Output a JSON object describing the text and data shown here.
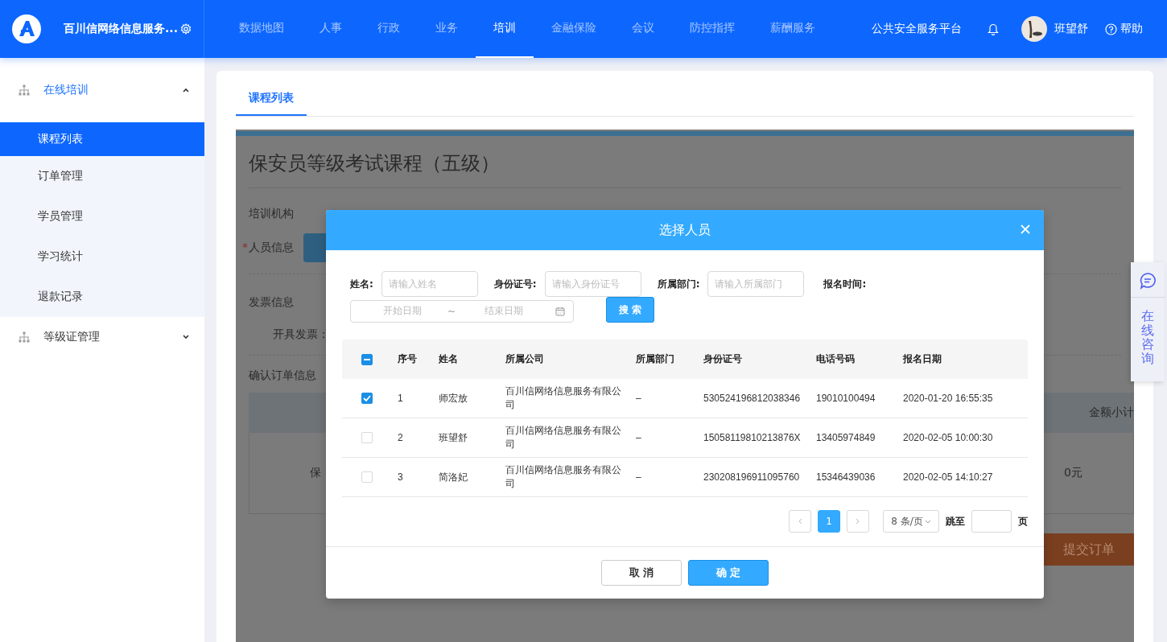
{
  "app": {
    "name": "百川信网络信息服务..."
  },
  "nav": [
    {
      "label": "数据地图",
      "selected": false
    },
    {
      "label": "人事",
      "selected": false
    },
    {
      "label": "行政",
      "selected": false
    },
    {
      "label": "业务",
      "selected": false
    },
    {
      "label": "培训",
      "selected": true
    },
    {
      "label": "金融保险",
      "selected": false
    },
    {
      "label": "会议",
      "selected": false
    },
    {
      "label": "防控指挥",
      "selected": false
    },
    {
      "label": "薪酬服务",
      "selected": false
    }
  ],
  "header_right": {
    "platform": "公共安全服务平台",
    "user": "班望舒",
    "help": "帮助"
  },
  "sidebar": [
    {
      "label": "在线培训",
      "expanded": true,
      "children": [
        {
          "label": "课程列表",
          "selected": true
        },
        {
          "label": "订单管理",
          "selected": false
        },
        {
          "label": "学员管理",
          "selected": false
        },
        {
          "label": "学习统计",
          "selected": false
        },
        {
          "label": "退款记录",
          "selected": false
        }
      ]
    },
    {
      "label": "等级证管理",
      "expanded": false
    }
  ],
  "page_tabs": [
    {
      "label": "课程列表",
      "selected": true
    }
  ],
  "course": {
    "title": "保安员等级考试课程（五级）",
    "org_label": "培训机构",
    "people_label": "人员信息",
    "required_mark": "*",
    "invoice_title": "发票信息",
    "invoice_label": "开具发票：",
    "order_title": "确认订单信息",
    "order_header": "金额小计",
    "order_item": "保",
    "order_amount": "0元",
    "submit": "提交订单"
  },
  "modal": {
    "title": "选择人员",
    "filters": [
      {
        "label": "姓名:",
        "placeholder": "请输入姓名"
      },
      {
        "label": "身份证号:",
        "placeholder": "请输入身份证号"
      },
      {
        "label": "所属部门:",
        "placeholder": "请输入所属部门"
      }
    ],
    "date_label": "报名时间:",
    "date_start": "开始日期",
    "date_sep": "~",
    "date_end": "结束日期",
    "search": "搜 索",
    "select_all_indeterminate": true,
    "columns": [
      "序号",
      "姓名",
      "所属公司",
      "所属部门",
      "身份证号",
      "电话号码",
      "报名日期"
    ],
    "rows": [
      {
        "selected": true,
        "cells": [
          "1",
          "师宏放",
          "百川信网络信息服务有限公司",
          "–",
          "530524196812038346",
          "19010100494",
          "2020-01-20 16:55:35"
        ]
      },
      {
        "selected": false,
        "cells": [
          "2",
          "班望舒",
          "百川信网络信息服务有限公司",
          "–",
          "15058119810213876X",
          "13405974849",
          "2020-02-05 10:00:30"
        ]
      },
      {
        "selected": false,
        "cells": [
          "3",
          "简洛妃",
          "百川信网络信息服务有限公司",
          "–",
          "230208196911095760",
          "15346439036",
          "2020-02-05 14:10:27"
        ]
      }
    ],
    "pagination": {
      "pages": [
        {
          "label": "1",
          "selected": true
        }
      ],
      "page_size": "8 条/页",
      "jump_label": "跳至",
      "jump_suffix": "页"
    },
    "cancel": "取 消",
    "ok": "确 定"
  },
  "float_widget": {
    "label": "在线咨询"
  }
}
